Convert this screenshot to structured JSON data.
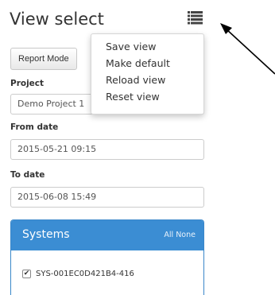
{
  "header": {
    "title": "View select",
    "menu_icon": "list-icon"
  },
  "toolbar": {
    "report_mode_label": "Report Mode"
  },
  "view_menu": {
    "items": [
      "Save view",
      "Make default",
      "Reload view",
      "Reset view"
    ]
  },
  "form": {
    "project_label": "Project",
    "project_value": "Demo Project 1",
    "from_label": "From date",
    "from_value": "2015-05-21 09:15",
    "to_label": "To date",
    "to_value": "2015-06-08 15:49"
  },
  "systems": {
    "title": "Systems",
    "all_label": "All",
    "none_label": "None",
    "items": [
      {
        "label": "SYS-001EC0D421B4-416",
        "checked": true
      }
    ]
  },
  "colors": {
    "accent": "#3b8dd3"
  }
}
